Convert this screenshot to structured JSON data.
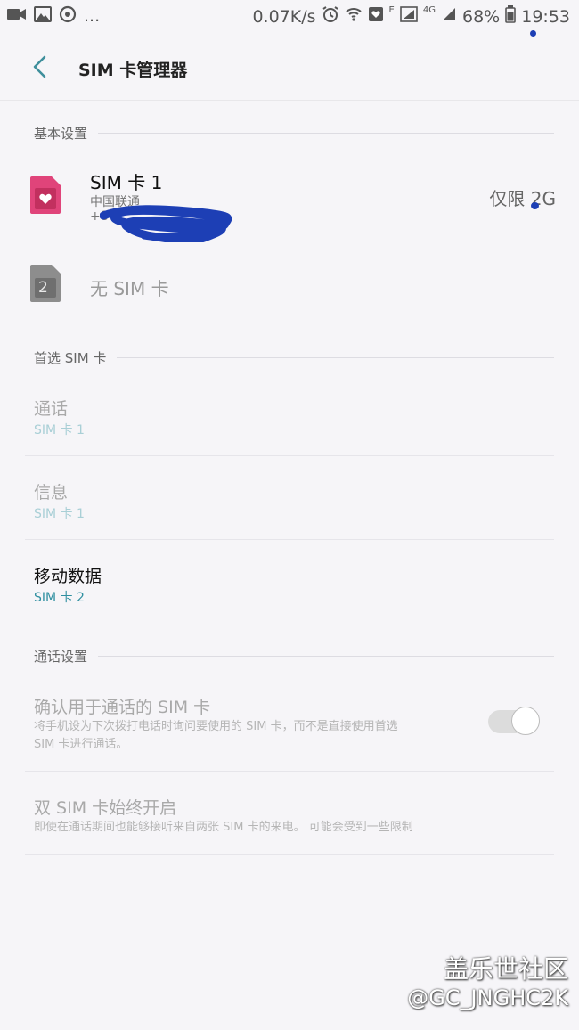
{
  "status_bar": {
    "more": "...",
    "net_speed": "0.07K/s",
    "net_e": "E",
    "net_4g": "4G",
    "battery": "68%",
    "time": "19:53"
  },
  "header": {
    "title": "SIM 卡管理器"
  },
  "basic_settings": {
    "heading": "基本设置",
    "sim1": {
      "title": "SIM 卡 1",
      "carrier": "中国联通",
      "number": "+8",
      "mode": "仅限 2G"
    },
    "sim2": {
      "badge": "2",
      "label": "无 SIM 卡"
    }
  },
  "preferred_sim": {
    "heading": "首选 SIM 卡",
    "items": [
      {
        "title": "通话",
        "value": "SIM 卡 1"
      },
      {
        "title": "信息",
        "value": "SIM 卡 1"
      },
      {
        "title": "移动数据",
        "value": "SIM 卡 2"
      }
    ]
  },
  "call_settings": {
    "heading": "通话设置",
    "confirm": {
      "title": "确认用于通话的 SIM 卡",
      "desc_line1": "将手机设为下次拨打电话时询问要使用的 SIM 卡，而不是直接使用首选",
      "desc_line2": "SIM 卡进行通话。",
      "enabled": false
    },
    "dual": {
      "title": "双 SIM 卡始终开启",
      "desc": "即使在通话期间也能够接听来自两张 SIM 卡的来电。 可能会受到一些限制"
    }
  },
  "watermark": {
    "line1": "盖乐世社区",
    "line2": "@GC_JNGHC2K"
  },
  "colors": {
    "accent_teal": "#2f8fa0",
    "sim1_pink": "#e0447a",
    "scribble_blue": "#1d3fb5"
  }
}
